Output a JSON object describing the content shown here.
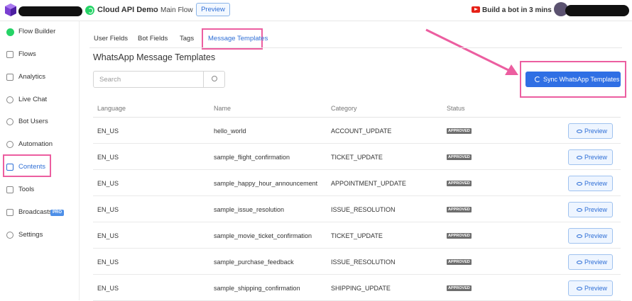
{
  "topbar": {
    "project_name": "Cloud API Demo",
    "breadcrumb_separator": ">",
    "flow_name": "Main Flow",
    "preview_label": "Preview",
    "build_link_label": "Build a bot in 3 mins"
  },
  "sidebar": {
    "items": [
      {
        "label": "Flow Builder",
        "icon": "whatsapp-icon"
      },
      {
        "label": "Flows",
        "icon": "grid-icon"
      },
      {
        "label": "Analytics",
        "icon": "analytics-icon"
      },
      {
        "label": "Live Chat",
        "icon": "headset-icon"
      },
      {
        "label": "Bot Users",
        "icon": "user-icon"
      },
      {
        "label": "Automation",
        "icon": "automation-icon"
      },
      {
        "label": "Contents",
        "icon": "contents-icon"
      },
      {
        "label": "Tools",
        "icon": "tools-icon"
      },
      {
        "label": "Broadcasts",
        "icon": "megaphone-icon",
        "badge": "PRO"
      },
      {
        "label": "Settings",
        "icon": "gear-icon"
      }
    ]
  },
  "tabs": [
    {
      "label": "User Fields"
    },
    {
      "label": "Bot Fields"
    },
    {
      "label": "Tags"
    },
    {
      "label": "Message Templates"
    }
  ],
  "page_title": "WhatsApp Message Templates",
  "search": {
    "placeholder": "Search"
  },
  "sync_button_label": "Sync WhatsApp Templates",
  "table": {
    "headers": [
      "Language",
      "Name",
      "Category",
      "Status"
    ],
    "rows": [
      {
        "language": "EN_US",
        "name": "hello_world",
        "category": "ACCOUNT_UPDATE",
        "status": "APPROVED",
        "action": "Preview"
      },
      {
        "language": "EN_US",
        "name": "sample_flight_confirmation",
        "category": "TICKET_UPDATE",
        "status": "APPROVED",
        "action": "Preview"
      },
      {
        "language": "EN_US",
        "name": "sample_happy_hour_announcement",
        "category": "APPOINTMENT_UPDATE",
        "status": "APPROVED",
        "action": "Preview"
      },
      {
        "language": "EN_US",
        "name": "sample_issue_resolution",
        "category": "ISSUE_RESOLUTION",
        "status": "APPROVED",
        "action": "Preview"
      },
      {
        "language": "EN_US",
        "name": "sample_movie_ticket_confirmation",
        "category": "TICKET_UPDATE",
        "status": "APPROVED",
        "action": "Preview"
      },
      {
        "language": "EN_US",
        "name": "sample_purchase_feedback",
        "category": "ISSUE_RESOLUTION",
        "status": "APPROVED",
        "action": "Preview"
      },
      {
        "language": "EN_US",
        "name": "sample_shipping_confirmation",
        "category": "SHIPPING_UPDATE",
        "status": "APPROVED",
        "action": "Preview"
      }
    ]
  },
  "colors": {
    "accent": "#2f6fe4",
    "highlight": "#ec5ea0",
    "status_badge": "#6e6e6e",
    "whatsapp": "#25d366"
  }
}
